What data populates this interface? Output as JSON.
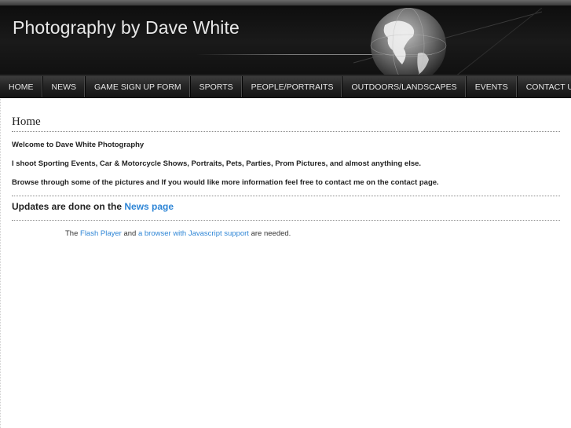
{
  "header": {
    "site_title": "Photography by Dave White"
  },
  "nav": {
    "items": [
      {
        "label": "HOME"
      },
      {
        "label": "NEWS"
      },
      {
        "label": "GAME SIGN UP FORM"
      },
      {
        "label": "SPORTS"
      },
      {
        "label": "PEOPLE/PORTRAITS"
      },
      {
        "label": "OUTDOORS/LANDSCAPES"
      },
      {
        "label": "EVENTS"
      },
      {
        "label": "CONTACT US"
      }
    ]
  },
  "main": {
    "heading": "Home",
    "paragraphs": [
      "Welcome to Dave White Photography",
      "I shoot Sporting Events, Car & Motorcycle Shows, Portraits, Pets, Parties, Prom Pictures, and almost anything else.",
      "Browse through some of the pictures and  If you would like more information feel free to  contact me on the contact page."
    ],
    "updates": {
      "prefix": "Updates are done on the ",
      "link": "News page"
    },
    "flash_notice": {
      "prefix": "The ",
      "flash_link": "Flash Player",
      "middle": " and ",
      "browser_link": "a browser with Javascript support",
      "suffix": " are needed."
    }
  },
  "colors": {
    "link": "#2f86d6",
    "header_bg": "#111111",
    "nav_bg": "#232323"
  },
  "icons": [
    "globe-graphic"
  ]
}
